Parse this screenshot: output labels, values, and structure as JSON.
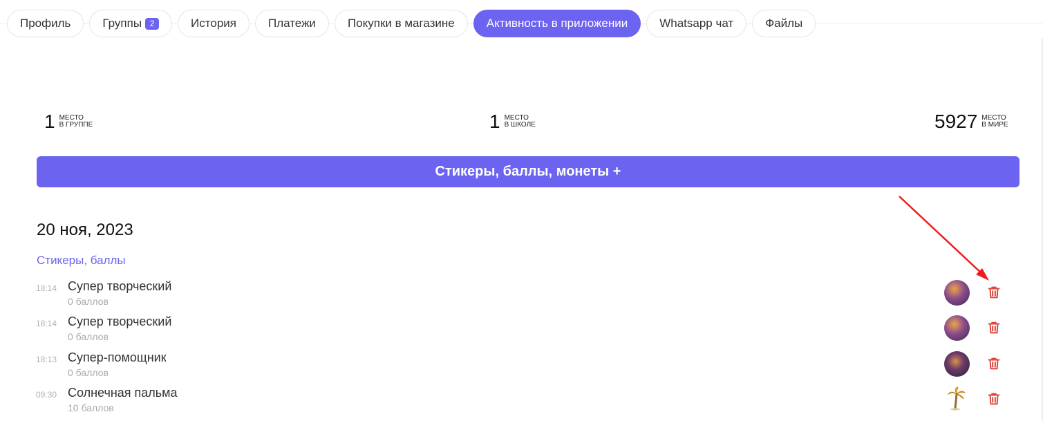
{
  "tabs": [
    {
      "label": "Профиль"
    },
    {
      "label": "Группы",
      "badge": "2"
    },
    {
      "label": "История"
    },
    {
      "label": "Платежи"
    },
    {
      "label": "Покупки в магазине"
    },
    {
      "label": "Активность в приложении",
      "active": true
    },
    {
      "label": "Whatsapp чат"
    },
    {
      "label": "Файлы"
    }
  ],
  "stats": [
    {
      "value": "1",
      "label1": "МЕСТО",
      "label2": "В ГРУППЕ"
    },
    {
      "value": "1",
      "label1": "МЕСТО",
      "label2": "В ШКОЛЕ"
    },
    {
      "value": "5927",
      "label1": "МЕСТО",
      "label2": "В МИРЕ"
    }
  ],
  "main_button": "Стикеры, баллы, монеты +",
  "date": "20 ноя, 2023",
  "section": "Стикеры, баллы",
  "entries": [
    {
      "time": "18:14",
      "title": "Супер творческий",
      "points": "0 баллов"
    },
    {
      "time": "18:14",
      "title": "Супер творческий",
      "points": "0 баллов"
    },
    {
      "time": "18:13",
      "title": "Супер-помощник",
      "points": "0 баллов"
    },
    {
      "time": "09:30",
      "title": "Солнечная пальма",
      "points": "10 баллов"
    }
  ],
  "colors": {
    "accent": "#6c63f0",
    "delete": "#e0463b",
    "annotation_arrow": "#f01c1c"
  },
  "icons": {
    "delete": "trash-icon",
    "sticker": "sticker-avatar",
    "palm": "palm-tree-icon"
  }
}
